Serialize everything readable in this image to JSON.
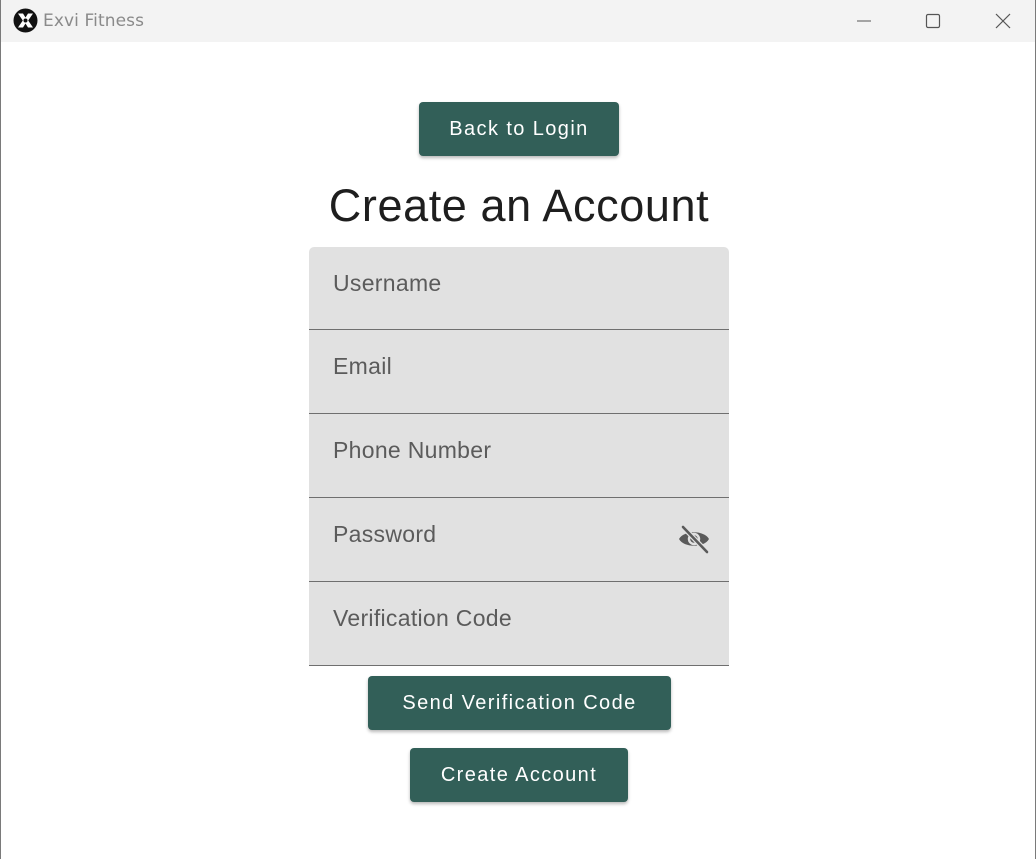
{
  "window": {
    "title": "Exvi Fitness",
    "app_icon": "exvi-logo-icon",
    "controls": [
      "minimize-icon",
      "maximize-icon",
      "close-icon"
    ]
  },
  "page": {
    "back_button_label": "Back to Login",
    "title": "Create an Account",
    "send_code_label": "Send Verification Code",
    "create_account_label": "Create Account"
  },
  "form": {
    "username": {
      "placeholder": "Username",
      "value": ""
    },
    "email": {
      "placeholder": "Email",
      "value": ""
    },
    "phone": {
      "placeholder": "Phone Number",
      "value": ""
    },
    "password": {
      "placeholder": "Password",
      "value": "",
      "toggle_icon": "eye-slash-icon"
    },
    "verification_code": {
      "placeholder": "Verification Code",
      "value": ""
    }
  },
  "colors": {
    "accent": "#325f58",
    "field_background": "#e1e1e1",
    "titlebar": "#f3f3f3"
  }
}
